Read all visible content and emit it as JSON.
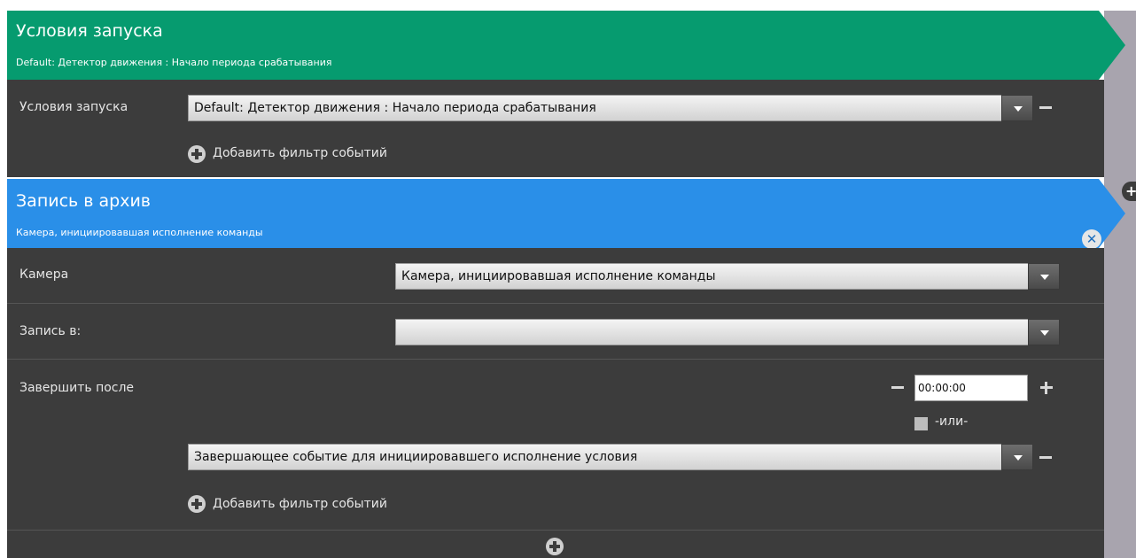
{
  "launch": {
    "header_title": "Условия запуска",
    "header_subtitle": "Default: Детектор движения : Начало периода срабатывания",
    "field_label": "Условия запуска",
    "condition_value": "Default: Детектор движения : Начало периода срабатывания",
    "add_filter_label": "Добавить фильтр событий",
    "color": "#069b6f"
  },
  "record": {
    "header_title": "Запись в архив",
    "header_subtitle": "Камера, инициировавшая исполнение команды",
    "color": "#2a8fe8",
    "camera_label": "Камера",
    "camera_value": "Камера, инициировавшая исполнение команды",
    "record_to_label": "Запись в:",
    "record_to_value": "",
    "finish_label": "Завершить после",
    "finish_time": "00:00:00",
    "or_label": "-или-",
    "end_event_value": "Завершающее событие для инициировавшего исполнение условия",
    "add_filter_label": "Добавить фильтр событий"
  }
}
